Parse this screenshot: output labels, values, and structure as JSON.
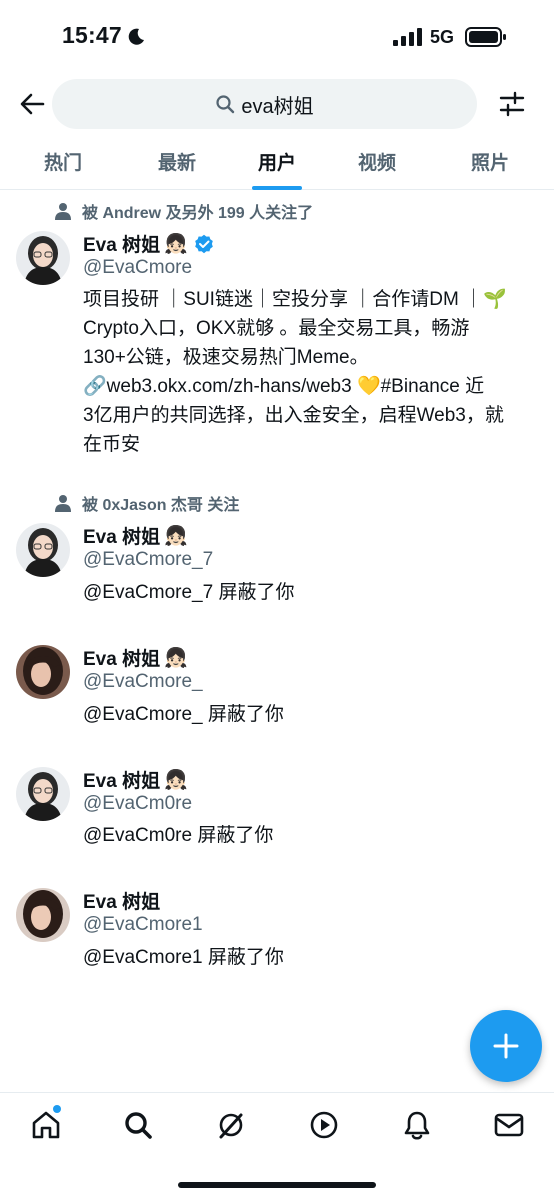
{
  "status_bar": {
    "time": "15:47",
    "network": "5G"
  },
  "search": {
    "query": "eva树姐"
  },
  "tabs": [
    {
      "label": "热门",
      "active": false
    },
    {
      "label": "最新",
      "active": false
    },
    {
      "label": "用户",
      "active": true
    },
    {
      "label": "视频",
      "active": false
    },
    {
      "label": "照片",
      "active": false
    }
  ],
  "users": [
    {
      "social_context": "被 Andrew 及另外 199 人关注了",
      "name": "Eva 树姐",
      "name_emoji": "👧🏻",
      "verified": true,
      "handle": "@EvaCmore",
      "bio_lines": [
        "项目投研 ｜SUI链迷｜空投分享 ｜合作请DM ｜🌱",
        "Crypto入口，OKX就够 。最全交易工具，畅游",
        "130+公链，极速交易热门Meme。",
        "🔗web3.okx.com/zh-hans/web3 💛#Binance 近",
        "3亿用户的共同选择，出入金安全，启程Web3，就",
        "在币安"
      ]
    },
    {
      "social_context": "被 0xJason 杰哥 关注",
      "name": "Eva 树姐",
      "name_emoji": "👧🏻",
      "handle": "@EvaCmore_7",
      "bio_lines": [
        "@EvaCmore_7 屏蔽了你"
      ]
    },
    {
      "name": "Eva 树姐",
      "name_emoji": "👧🏻",
      "handle": "@EvaCmore_",
      "bio_lines": [
        "@EvaCmore_ 屏蔽了你"
      ]
    },
    {
      "name": "Eva 树姐",
      "name_emoji": "👧🏻",
      "handle": "@EvaCm0re",
      "bio_lines": [
        "@EvaCm0re 屏蔽了你"
      ]
    },
    {
      "name": "Eva 树姐",
      "name_emoji": "",
      "handle": "@EvaCmore1",
      "bio_lines": [
        "@EvaCmore1 屏蔽了你"
      ]
    }
  ],
  "nav": {
    "items": [
      "home-icon",
      "search-icon",
      "grok-icon",
      "play-icon",
      "bell-icon",
      "mail-icon"
    ]
  },
  "colors": {
    "accent": "#1d9bf0",
    "text_primary": "#0f1419",
    "text_secondary": "#536471"
  }
}
